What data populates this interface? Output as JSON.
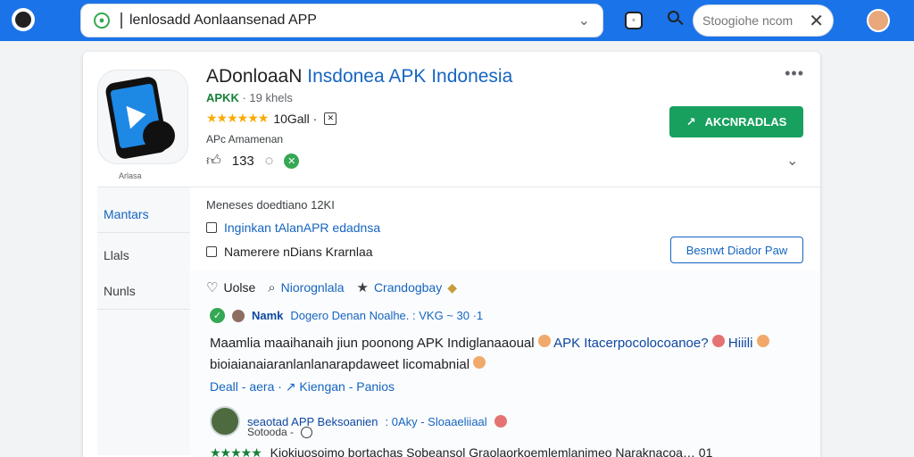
{
  "browser": {
    "url_text": "lenlosadd Aonlaansenad APP",
    "search_placeholder": "Stoogiohe ncom"
  },
  "app": {
    "title_black": "ADonloaaN",
    "title_blue": "Insdonea APK Indonesia",
    "developer": "APKK",
    "age_label": "· 19 khels",
    "stars": "★★★★★★",
    "rating_count": "10Gall ·",
    "category": "APc Amamenan",
    "icon_caption": "Arlasa",
    "thumb_count": "133",
    "install_label": "AKCNRADLAS"
  },
  "info": {
    "line1": "Meneses doedtiano 12KI",
    "link_row": "Inginkan tAlanAPR edadnsa",
    "plain_row": "Namerere nDians Krarnlaa",
    "button_label": "Besnwt Diador Paw"
  },
  "sidebar": {
    "items": [
      {
        "label": "Mantars"
      },
      {
        "label": "Llals"
      },
      {
        "label": "Nunls"
      }
    ]
  },
  "reviews": {
    "tabs": [
      {
        "label": "Uolse"
      },
      {
        "label": "Niorognlala"
      },
      {
        "label": "Crandogbay"
      }
    ],
    "r1": {
      "name": "Namk",
      "meta": "Dogero Denan Noalhe. : VKG ~ 30 ·1",
      "text_a": "Maamlia maaihanaih jiun poonong APK Indiglanaaoual",
      "text_b": "APK Itacerpocolocoanoe?",
      "text_c": "Hiiili",
      "text_d": "bioiaianaiaranlanlanarapdaweet licomabnial",
      "actions": "Deall - aera  ·  ↗ Kiengan - Panios"
    },
    "r2": {
      "title": "seaotad APP Beksoanien",
      "meta": ": 0Aky - Sloaaeliiaal",
      "sub": "Sotooda -",
      "stars": "★★★★★",
      "text": "Kiokiuosoimo bortachas Sobeansol Graolaorkoemlemlanimeo Naraknacoa… 01"
    }
  }
}
